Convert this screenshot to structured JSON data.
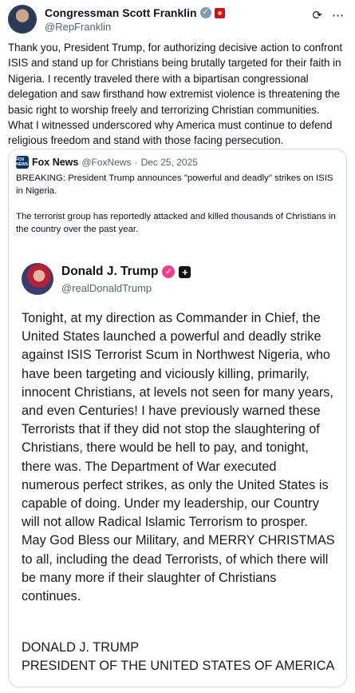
{
  "post": {
    "author_name": "Congressman Scott Franklin",
    "author_handle": "@RepFranklin",
    "text": "Thank you, President Trump, for authorizing decisive action to confront ISIS and stand up for Christians being brutally targeted for their faith in Nigeria. I recently traveled there with a bipartisan congressional delegation and saw firsthand how extremist violence is threatening the basic right to worship freely and terrorizing Christian communities. What I witnessed underscored why America must continue to defend religious freedom and stand with those facing persecution."
  },
  "quote": {
    "logo_text": "FOX NEWS",
    "author_name": "Fox News",
    "author_handle": "@FoxNews",
    "separator": "·",
    "date": "Dec 25, 2025",
    "paragraphs": [
      "BREAKING: President Trump announces \"powerful and deadly\" strikes on ISIS in Nigeria.",
      "The terrorist group has reportedly attacked and killed thousands of Christians in the country over the past year."
    ]
  },
  "embedded": {
    "author_name": "Donald J. Trump",
    "author_handle": "@realDonaldTrump",
    "body": "Tonight, at my direction as Commander in Chief, the United States launched a powerful and deadly strike against ISIS Terrorist Scum in Northwest Nigeria, who have been targeting and viciously killing, primarily, innocent Christians, at levels not seen for many years, and even Centuries! I have previously warned these Terrorists that if they did not stop the slaughtering of Christians, there would be hell to pay, and tonight, there was. The Department of War executed numerous perfect strikes, as only the United States is capable of doing. Under my leadership, our Country will not allow Radical Islamic Terrorism to prosper. May God Bless our Military, and MERRY CHRISTMAS to all, including the dead Terrorists, of which there will be many more if their slaughter of Christians continues.",
    "signature_name": "DONALD J. TRUMP",
    "signature_title": "PRESIDENT OF THE UNITED STATES OF AMERICA"
  },
  "icons": {
    "verified": "verified-badge-icon",
    "flag": "flag-icon",
    "grok": "grok-icon",
    "more": "more-icon"
  }
}
